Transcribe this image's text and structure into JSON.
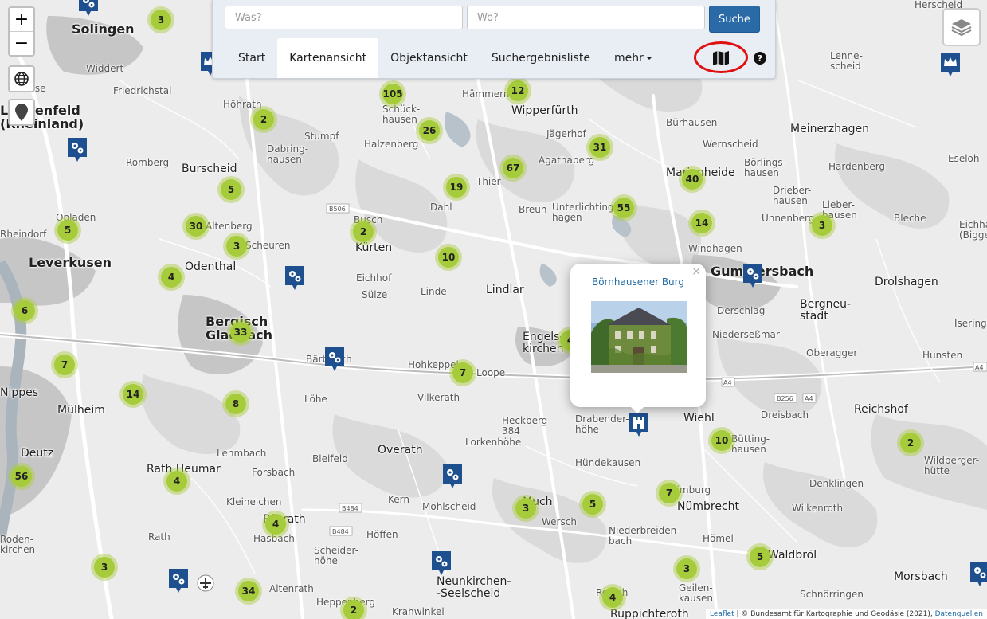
{
  "search": {
    "what_placeholder": "Was?",
    "where_placeholder": "Wo?",
    "button_label": "Suche"
  },
  "tabs": [
    {
      "label": "Start",
      "active": false
    },
    {
      "label": "Kartenansicht",
      "active": true
    },
    {
      "label": "Objektansicht",
      "active": false
    },
    {
      "label": "Suchergebnisliste",
      "active": false
    },
    {
      "label": "mehr",
      "active": false
    }
  ],
  "controls": {
    "zoom_in": "+",
    "zoom_out": "−",
    "help": "?"
  },
  "popup": {
    "title": "Börnhausener Burg",
    "close": "×"
  },
  "attribution": {
    "leaflet": "Leaflet",
    "separator": " | ",
    "text": "© Bundesamt für Kartographie und Geodäsie (2021),",
    "sources": "Datenquellen"
  },
  "colors": {
    "cluster": "#a6cc3b",
    "marker": "#1e4f8f",
    "button": "#2a6aa7",
    "highlight": "#e01010"
  },
  "places": [
    {
      "text": "Solingen",
      "size": "l"
    },
    {
      "text": "Widdert",
      "size": "s"
    },
    {
      "text": "Friedrichstal",
      "size": "s"
    },
    {
      "text": "Höhrath",
      "size": "s"
    },
    {
      "text": "Stumpf",
      "size": "s"
    },
    {
      "text": "Dabring-\nhausen",
      "size": "s"
    },
    {
      "text": "Burscheid",
      "size": "m"
    },
    {
      "text": "Romberg",
      "size": "s"
    },
    {
      "text": "Opladen",
      "size": "s"
    },
    {
      "text": "Rheindorf",
      "size": "s"
    },
    {
      "text": "Leverkusen",
      "size": "l"
    },
    {
      "text": "Altenberg",
      "size": "s"
    },
    {
      "text": "Scheuren",
      "size": "s"
    },
    {
      "text": "Odenthal",
      "size": "m"
    },
    {
      "text": "Bergisch\nGladbach",
      "size": "l"
    },
    {
      "text": "Nippes",
      "size": "m"
    },
    {
      "text": "Mülheim",
      "size": "m"
    },
    {
      "text": "Deutz",
      "size": "m"
    },
    {
      "text": "Rath Heumar",
      "size": "m"
    },
    {
      "text": "Bärbroich",
      "size": "s"
    },
    {
      "text": "Löhe",
      "size": "s"
    },
    {
      "text": "Lehmbach",
      "size": "s"
    },
    {
      "text": "Forsbach",
      "size": "s"
    },
    {
      "text": "Kleineichen",
      "size": "s"
    },
    {
      "text": "Hasbach",
      "size": "s"
    },
    {
      "text": "Rösrath",
      "size": "m"
    },
    {
      "text": "Altenrath",
      "size": "s"
    },
    {
      "text": "Heppenberg",
      "size": "s"
    },
    {
      "text": "Schück-\nhausen",
      "size": "s"
    },
    {
      "text": "Halzenberg",
      "size": "s"
    },
    {
      "text": "Hämmern",
      "size": "s"
    },
    {
      "text": "Wipperfürth",
      "size": "m"
    },
    {
      "text": "Jägerhof",
      "size": "s"
    },
    {
      "text": "Agathaberg",
      "size": "s"
    },
    {
      "text": "Thier",
      "size": "s"
    },
    {
      "text": "Dahl",
      "size": "s"
    },
    {
      "text": "Breun",
      "size": "s"
    },
    {
      "text": "Unterlichting\nhagen",
      "size": "s"
    },
    {
      "text": "Busch",
      "size": "s"
    },
    {
      "text": "Kürten",
      "size": "m"
    },
    {
      "text": "Eichhof",
      "size": "s"
    },
    {
      "text": "Sülze",
      "size": "s"
    },
    {
      "text": "Linde",
      "size": "s"
    },
    {
      "text": "Lindlar",
      "size": "m"
    },
    {
      "text": "Hohkeppel",
      "size": "s"
    },
    {
      "text": "Loope",
      "size": "s"
    },
    {
      "text": "Vilkerath",
      "size": "s"
    },
    {
      "text": "Lorkenhöhe",
      "size": "s"
    },
    {
      "text": "Overath",
      "size": "m"
    },
    {
      "text": "Bleifeld",
      "size": "s"
    },
    {
      "text": "Kern",
      "size": "s"
    },
    {
      "text": "Mohlscheid",
      "size": "s"
    },
    {
      "text": "Höffen",
      "size": "s"
    },
    {
      "text": "Scheider-\nhöhe",
      "size": "s"
    },
    {
      "text": "Neunkirchen-\n-Seelscheid",
      "size": "m"
    },
    {
      "text": "Krahwinkel",
      "size": "s"
    },
    {
      "text": "Wersch",
      "size": "s"
    },
    {
      "text": "Much",
      "size": "m"
    },
    {
      "text": "Hündekausen",
      "size": "s"
    },
    {
      "text": "Drabender-\nhöhe",
      "size": "s"
    },
    {
      "text": "Engels-\nkirchen",
      "size": "m"
    },
    {
      "text": "Bürhausen",
      "size": "s"
    },
    {
      "text": "Marienheide",
      "size": "m"
    },
    {
      "text": "Wernscheid",
      "size": "s"
    },
    {
      "text": "Börlings-\nhausen",
      "size": "s"
    },
    {
      "text": "Meinerzhagen",
      "size": "m"
    },
    {
      "text": "Hardenberg",
      "size": "s"
    },
    {
      "text": "Drieber-\nhausen",
      "size": "s"
    },
    {
      "text": "Lieber-\nhausen",
      "size": "s"
    },
    {
      "text": "Unnenberg",
      "size": "s"
    },
    {
      "text": "Windhagen",
      "size": "s"
    },
    {
      "text": "Gummersbach",
      "size": "l"
    },
    {
      "text": "Derschlag",
      "size": "s"
    },
    {
      "text": "Niederseßmar",
      "size": "s"
    },
    {
      "text": "Bergneu-\nstadt",
      "size": "m"
    },
    {
      "text": "Drolshagen",
      "size": "m"
    },
    {
      "text": "Bleche",
      "size": "s"
    },
    {
      "text": "Oberagger",
      "size": "s"
    },
    {
      "text": "Hunsten",
      "size": "s"
    },
    {
      "text": "Iseringhausen",
      "size": "s"
    },
    {
      "text": "Wiehl",
      "size": "m"
    },
    {
      "text": "Dreisbach",
      "size": "s"
    },
    {
      "text": "Reichshof",
      "size": "m"
    },
    {
      "text": "Bütting-\nhausen",
      "size": "s"
    },
    {
      "text": "Denklingen",
      "size": "s"
    },
    {
      "text": "Nümbrecht",
      "size": "m"
    },
    {
      "text": "Wilkenroth",
      "size": "s"
    },
    {
      "text": "Niederbreiden-\nbach",
      "size": "s"
    },
    {
      "text": "Hömel",
      "size": "s"
    },
    {
      "text": "Waldbröl",
      "size": "m"
    },
    {
      "text": "Morsbach",
      "size": "m"
    },
    {
      "text": "Schnörringen",
      "size": "s"
    },
    {
      "text": "Geilen-\nkausen",
      "size": "s"
    },
    {
      "text": "Ruppichteroth",
      "size": "m"
    },
    {
      "text": "Retsch",
      "size": "s"
    },
    {
      "text": "Lenne-\nscheid",
      "size": "s"
    },
    {
      "text": "Herscheid",
      "size": "s"
    },
    {
      "text": "Eseloh",
      "size": "s"
    },
    {
      "text": "Wildberger-\nhütte",
      "size": "s"
    },
    {
      "text": "Eichha\n(Bigge",
      "size": "s"
    },
    {
      "text": "Bosse",
      "size": "s"
    },
    {
      "text": "Heckberg\n384",
      "size": "s"
    },
    {
      "text": "Eimburg",
      "size": "s"
    },
    {
      "text": "Rath",
      "size": "s"
    },
    {
      "text": "Roden-\nkirchen",
      "size": "s"
    },
    {
      "text": "Langenfeld\n(Rheinland)",
      "size": "l"
    }
  ],
  "clusters": [
    {
      "count": "3"
    },
    {
      "count": "105"
    },
    {
      "count": "12"
    },
    {
      "count": "2"
    },
    {
      "count": "26"
    },
    {
      "count": "31"
    },
    {
      "count": "67"
    },
    {
      "count": "5"
    },
    {
      "count": "19"
    },
    {
      "count": "40"
    },
    {
      "count": "55"
    },
    {
      "count": "14"
    },
    {
      "count": "3"
    },
    {
      "count": "5"
    },
    {
      "count": "30"
    },
    {
      "count": "3"
    },
    {
      "count": "2"
    },
    {
      "count": "10"
    },
    {
      "count": "4"
    },
    {
      "count": "6"
    },
    {
      "count": "33"
    },
    {
      "count": "7"
    },
    {
      "count": "7"
    },
    {
      "count": "14"
    },
    {
      "count": "8"
    },
    {
      "count": "10"
    },
    {
      "count": "2"
    },
    {
      "count": "56"
    },
    {
      "count": "4"
    },
    {
      "count": "3"
    },
    {
      "count": "5"
    },
    {
      "count": "7"
    },
    {
      "count": "4"
    },
    {
      "count": "5"
    },
    {
      "count": "3"
    },
    {
      "count": "3"
    },
    {
      "count": "34"
    },
    {
      "count": "4"
    },
    {
      "count": "2"
    },
    {
      "count": "4"
    }
  ],
  "markers": [
    {
      "icon": "gear-marker-icon"
    },
    {
      "icon": "gear-marker-icon"
    },
    {
      "icon": "gear-marker-icon"
    },
    {
      "icon": "gear-marker-icon"
    },
    {
      "icon": "gear-marker-icon"
    },
    {
      "icon": "gear-marker-icon"
    },
    {
      "icon": "gear-marker-icon"
    },
    {
      "icon": "gear-marker-icon"
    },
    {
      "icon": "castle-marker-icon"
    },
    {
      "icon": "crown-marker-icon"
    },
    {
      "icon": "gear-marker-icon"
    },
    {
      "icon": "gear-marker-icon"
    },
    {
      "icon": "gear-marker-icon"
    }
  ],
  "road_labels": [
    "B506",
    "A4",
    "B256",
    "A4",
    "B484",
    "B484",
    "A4"
  ]
}
